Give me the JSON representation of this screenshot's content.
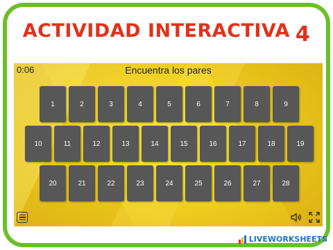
{
  "page": {
    "title": "ACTIVIDAD INTERACTIVA",
    "title_number": "4",
    "brand": "LIVEWORKSHEETS"
  },
  "game": {
    "timer": "0:06",
    "instruction": "Encuentra los pares",
    "cards": [
      "1",
      "2",
      "3",
      "4",
      "5",
      "6",
      "7",
      "8",
      "9",
      "10",
      "11",
      "12",
      "13",
      "14",
      "15",
      "16",
      "17",
      "18",
      "19",
      "20",
      "21",
      "22",
      "23",
      "24",
      "25",
      "26",
      "27",
      "28"
    ]
  },
  "icons": {
    "menu": "menu-icon",
    "sound": "speaker-icon",
    "fullscreen": "fullscreen-icon"
  },
  "colors": {
    "title": "#e0321b",
    "frame": "#6bbf2a",
    "card": "#575757",
    "background": "#f1d322",
    "brand": "#1b74c9"
  }
}
